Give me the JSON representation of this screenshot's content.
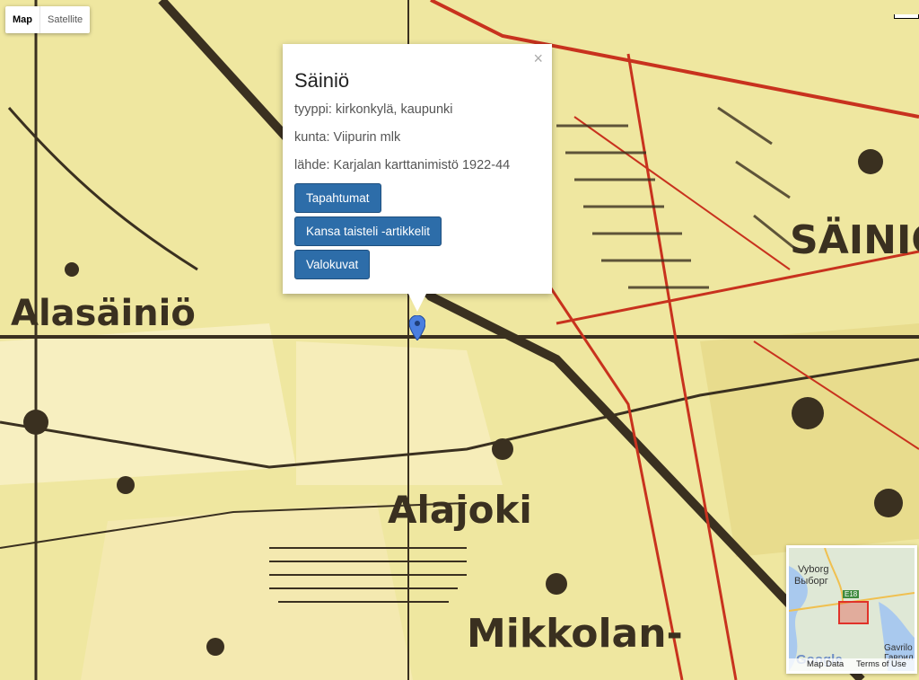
{
  "map_type_control": {
    "map": "Map",
    "satellite": "Satellite"
  },
  "base_map_labels": {
    "alasainio": "Alasäiniö",
    "sainio": "SÄINIÖ",
    "alajoki": "Alajoki",
    "mikkolan": "Mikkolan-"
  },
  "popup": {
    "title": "Säiniö",
    "type_row": "tyyppi: kirkonkylä, kaupunki",
    "municipality_row": "kunta: Viipurin mlk",
    "source_row": "lähde: Karjalan karttanimistö 1922-44",
    "close_label": "×",
    "buttons": {
      "events": "Tapahtumat",
      "articles": "Kansa taisteli -artikkelit",
      "photos": "Valokuvat"
    }
  },
  "minimap": {
    "city_fi": "Vyborg",
    "city_ru": "Выборг",
    "highway": "E18",
    "town_fi": "Gavrilo",
    "town_ru": "Гаврил",
    "logo": "Google",
    "map_data": "Map Data",
    "terms": "Terms of Use"
  }
}
